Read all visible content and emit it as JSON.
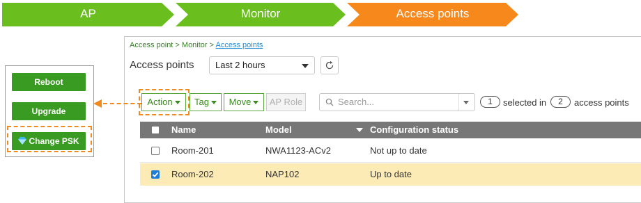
{
  "steps": [
    {
      "label": "AP",
      "color": "#6abf1f"
    },
    {
      "label": "Monitor",
      "color": "#6abf1f"
    },
    {
      "label": "Access points",
      "color": "#f7881c"
    }
  ],
  "breadcrumb": {
    "part1": "Access point >",
    "part2": "Monitor >",
    "current": "Access points"
  },
  "page_title": "Access points",
  "time_range": {
    "selected": "Last 2 hours"
  },
  "toolbar": {
    "action_label": "Action",
    "tag_label": "Tag",
    "move_label": "Move",
    "ap_role_label": "AP Role",
    "search_placeholder": "Search..."
  },
  "selection": {
    "selected_count": "1",
    "selected_in_text": "selected in",
    "total_count": "2",
    "suffix_text": "access points"
  },
  "table": {
    "columns": {
      "name": "Name",
      "model": "Model",
      "config": "Configuration status"
    },
    "rows": [
      {
        "name": "Room-201",
        "model": "NWA1123-ACv2",
        "config": "Not up to date",
        "checked": false
      },
      {
        "name": "Room-202",
        "model": "NAP102",
        "config": "Up to date",
        "checked": true
      }
    ]
  },
  "action_menu": {
    "reboot": "Reboot",
    "upgrade": "Upgrade",
    "change_psk": "Change PSK"
  },
  "colors": {
    "accent_green": "#3a9b22",
    "accent_orange": "#f08a1c",
    "selected_row": "#fcebb5",
    "header_gray": "#777777"
  }
}
